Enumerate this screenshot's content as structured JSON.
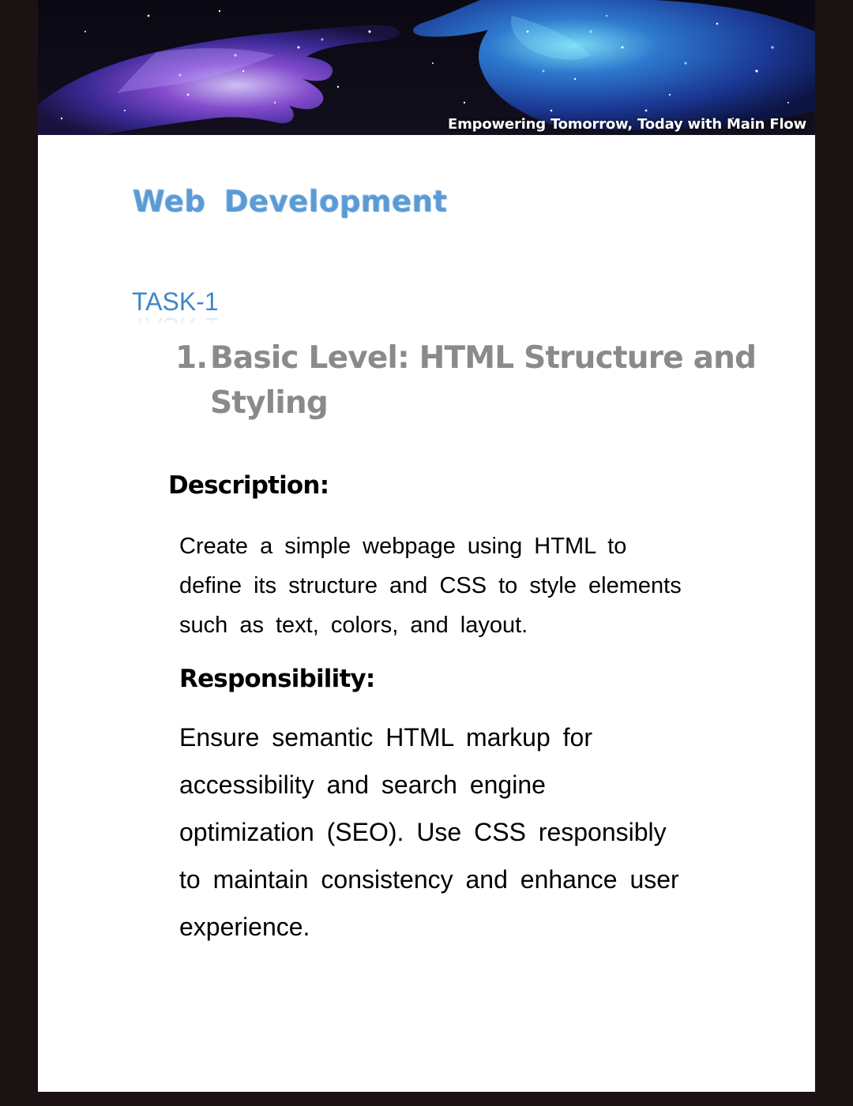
{
  "banner": {
    "tagline": "Empowering Tomorrow, Today with Main Flow"
  },
  "document": {
    "title": "Web  Development",
    "task_label": "TASK-1",
    "section": {
      "number": "1.",
      "title_lines": [
        "Basic Level: HTML Structure and",
        "Styling"
      ]
    },
    "description": {
      "heading": "Description:",
      "lines": [
        "Create a simple webpage using HTML to",
        "define its structure and CSS to style elements",
        "such as text, colors, and layout."
      ]
    },
    "responsibility": {
      "heading": "Responsibility:",
      "lines": [
        "Ensure semantic HTML markup for",
        "accessibility and search engine",
        "optimization (SEO). Use CSS responsibly",
        "to maintain consistency and enhance user",
        "experience."
      ]
    }
  },
  "colors": {
    "title_blue": "#5b9bd5",
    "task_blue": "#3f87c8",
    "heading_gray": "#8a8a8a",
    "frame_dark": "#1b1313"
  }
}
